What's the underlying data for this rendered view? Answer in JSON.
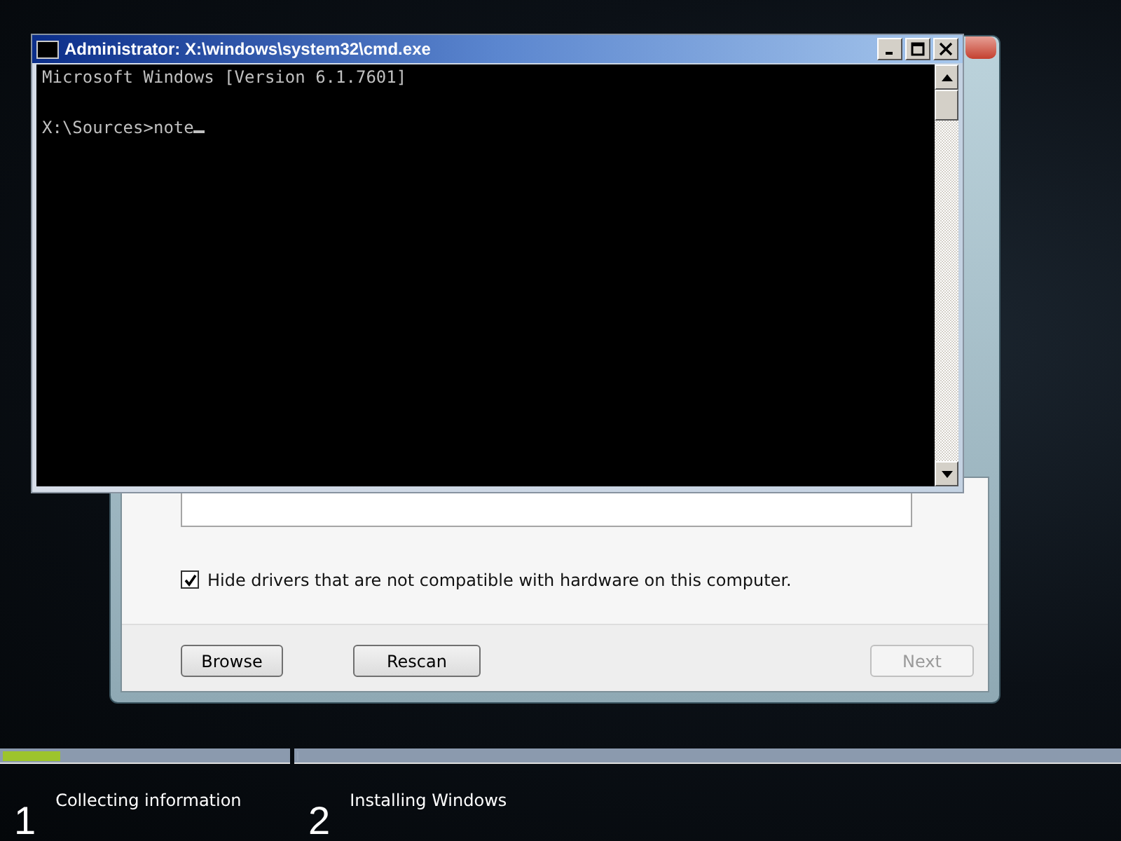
{
  "setup_dialog": {
    "hide_incompatible": {
      "label": "Hide drivers that are not compatible with hardware on this computer.",
      "checked": true
    },
    "buttons": [
      {
        "label": "Browse",
        "disabled": false
      },
      {
        "label": "Rescan",
        "disabled": false
      },
      {
        "label": "Next",
        "disabled": true
      }
    ]
  },
  "console": {
    "title": "Administrator: X:\\windows\\system32\\cmd.exe",
    "lines": [
      "Microsoft Windows [Version 6.1.7601]",
      "X:\\Sources>note"
    ]
  },
  "progress": [
    {
      "number": "1",
      "label": "Collecting information",
      "level": 0.2
    },
    {
      "number": "2",
      "label": "Installing Windows",
      "level": 0
    }
  ]
}
